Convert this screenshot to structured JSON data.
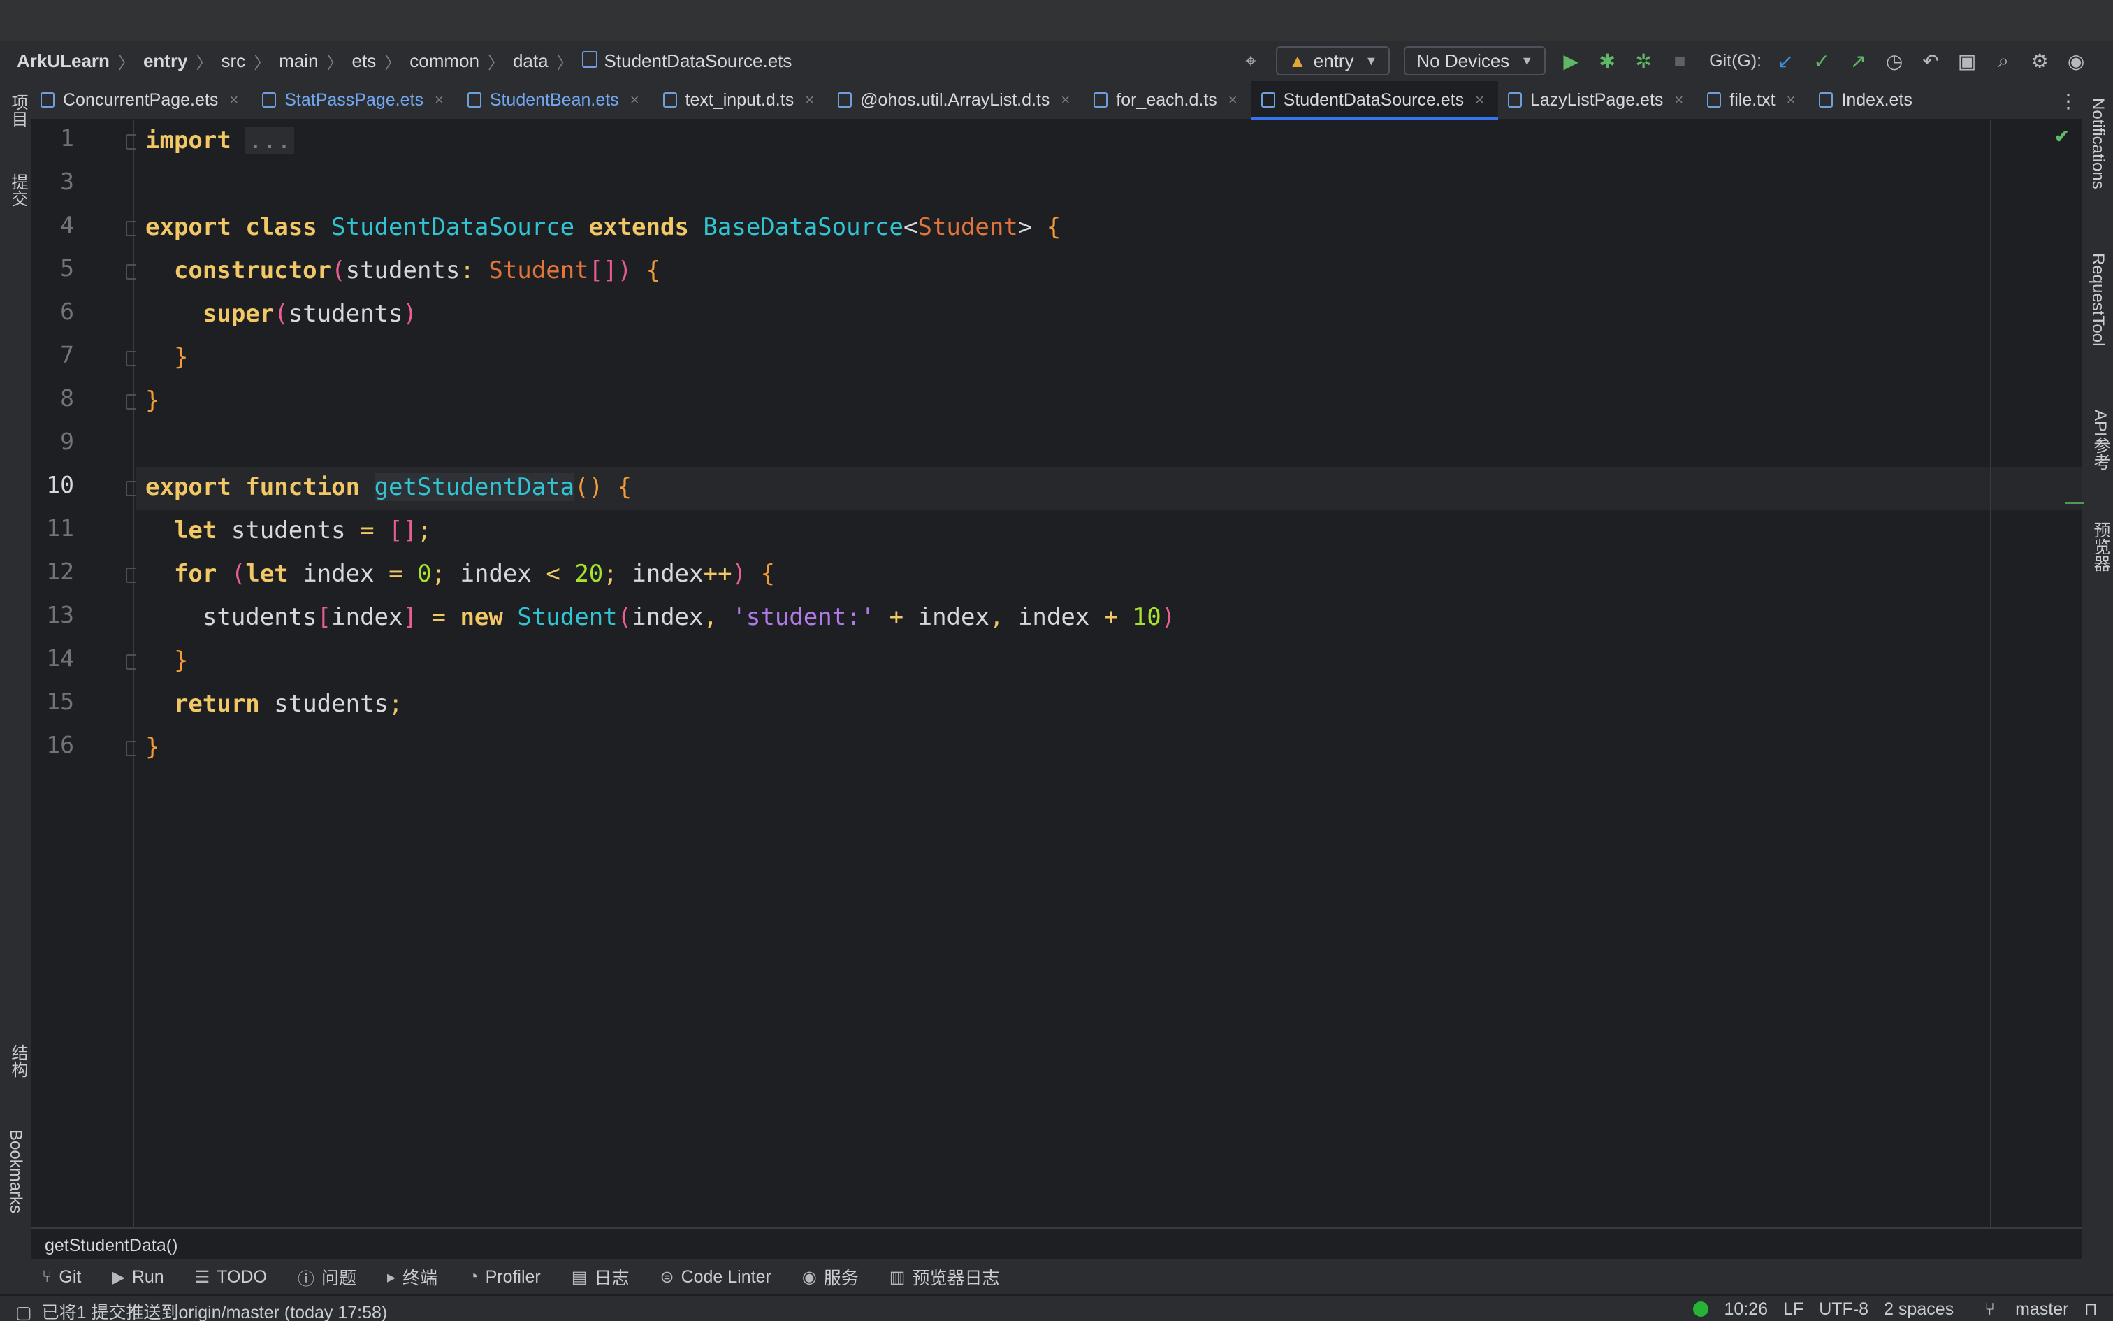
{
  "breadcrumb": [
    "ArkULearn",
    "entry",
    "src",
    "main",
    "ets",
    "common",
    "data",
    "StudentDataSource.ets"
  ],
  "toolbar": {
    "run_config": "entry",
    "device": "No Devices",
    "git_label": "Git(G):"
  },
  "tabs": [
    {
      "label": "ConcurrentPage.ets",
      "style": "normal"
    },
    {
      "label": "StatPassPage.ets",
      "style": "blue"
    },
    {
      "label": "StudentBean.ets",
      "style": "blue"
    },
    {
      "label": "text_input.d.ts",
      "style": "normal"
    },
    {
      "label": "@ohos.util.ArrayList.d.ts",
      "style": "normal"
    },
    {
      "label": "for_each.d.ts",
      "style": "normal"
    },
    {
      "label": "StudentDataSource.ets",
      "style": "active"
    },
    {
      "label": "LazyListPage.ets",
      "style": "normal"
    },
    {
      "label": "file.txt",
      "style": "normal"
    },
    {
      "label": "Index.ets",
      "style": "normal"
    }
  ],
  "left_sidebar": {
    "project": "项目",
    "commit": "提交",
    "structure": "结构",
    "bookmarks": "Bookmarks"
  },
  "right_sidebar": {
    "notifications": "Notifications",
    "request_tool": "RequestTool",
    "api_ref": "API参考",
    "previewer": "预览器"
  },
  "editor": {
    "line_numbers": [
      "1",
      "3",
      "4",
      "5",
      "6",
      "7",
      "8",
      "9",
      "10",
      "11",
      "12",
      "13",
      "14",
      "15",
      "16"
    ],
    "current_line": "10",
    "code": {
      "l1_import": "import",
      "l1_fold": "...",
      "l4_export": "export",
      "l4_class": "class",
      "l4_name": "StudentDataSource",
      "l4_extends": "extends",
      "l4_base": "BaseDataSource",
      "l4_type": "Student",
      "l5_ctor": "constructor",
      "l5_param": "students",
      "l5_type": "Student",
      "l6_super": "super",
      "l6_arg": "students",
      "l10_export": "export",
      "l10_function": "function",
      "l10_name": "getStudentData",
      "l11_let": "let",
      "l11_var": "students",
      "l12_for": "for",
      "l12_let": "let",
      "l12_index": "index",
      "l12_zero": "0",
      "l12_index2": "index",
      "l12_twenty": "20",
      "l12_index3": "index",
      "l13_students": "students",
      "l13_index": "index",
      "l13_new": "new",
      "l13_class": "Student",
      "l13_index2": "index",
      "l13_str": "'student:'",
      "l13_index3": "index",
      "l13_index4": "index",
      "l13_ten": "10",
      "l15_return": "return",
      "l15_var": "students"
    }
  },
  "code_breadcrumb": "getStudentData()",
  "tool_windows": [
    "Git",
    "Run",
    "TODO",
    "问题",
    "终端",
    "Profiler",
    "日志",
    "Code Linter",
    "服务",
    "预览器日志"
  ],
  "status": {
    "message": "已将1 提交推送到origin/master (today 17:58)",
    "position": "10:26",
    "line_sep": "LF",
    "encoding": "UTF-8",
    "indent": "2 spaces",
    "branch": "master"
  },
  "colors": {
    "accent": "#3574f0",
    "keyword": "#f2c866",
    "class_name": "#31c5d4",
    "type": "#e3753a",
    "number": "#a6e22e",
    "string": "#b07ae8",
    "status_ok": "#27b336"
  }
}
